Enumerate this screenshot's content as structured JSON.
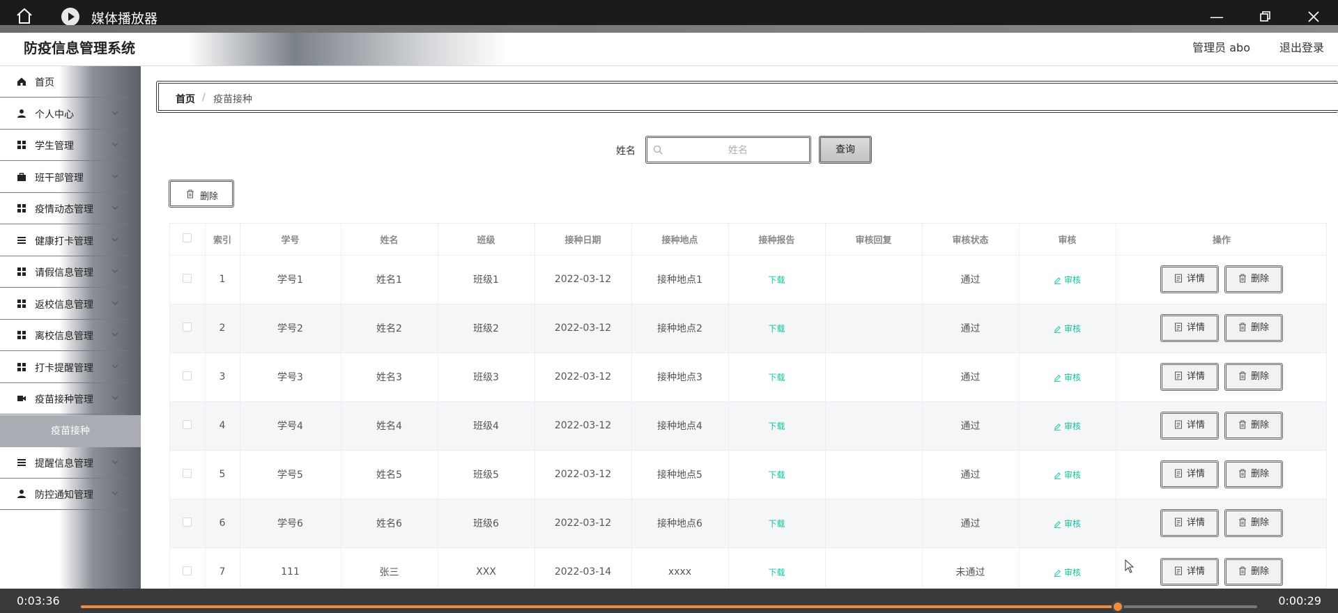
{
  "player": {
    "title": "媒体播放器",
    "time_elapsed": "0:03:36",
    "time_remaining": "0:00:29",
    "progress": 0.8813
  },
  "header": {
    "title": "防疫信息管理系统",
    "user": "管理员 abo",
    "logout": "退出登录"
  },
  "sidebar": {
    "items": [
      {
        "label": "首页",
        "icon": "home-icon",
        "chevron": false
      },
      {
        "label": "个人中心",
        "icon": "user-icon",
        "chevron": true
      },
      {
        "label": "学生管理",
        "icon": "grid-icon",
        "chevron": true
      },
      {
        "label": "班干部管理",
        "icon": "briefcase-icon",
        "chevron": true
      },
      {
        "label": "疫情动态管理",
        "icon": "grid-icon",
        "chevron": true
      },
      {
        "label": "健康打卡管理",
        "icon": "list-icon",
        "chevron": true
      },
      {
        "label": "请假信息管理",
        "icon": "grid-icon",
        "chevron": true
      },
      {
        "label": "返校信息管理",
        "icon": "grid-icon",
        "chevron": true
      },
      {
        "label": "离校信息管理",
        "icon": "grid-icon",
        "chevron": true
      },
      {
        "label": "打卡提醒管理",
        "icon": "grid-icon",
        "chevron": true
      },
      {
        "label": "疫苗接种管理",
        "icon": "camera-icon",
        "chevron": true
      },
      {
        "label": "提醒信息管理",
        "icon": "list-icon",
        "chevron": true
      },
      {
        "label": "防控通知管理",
        "icon": "user-icon",
        "chevron": true
      }
    ],
    "active_sub": "疫苗接种"
  },
  "breadcrumb": {
    "home": "首页",
    "separator": "/",
    "current": "疫苗接种"
  },
  "search": {
    "label": "姓名",
    "placeholder": "姓名",
    "button": "查询"
  },
  "bulk_delete": "删除",
  "table": {
    "columns": [
      "",
      "索引",
      "学号",
      "姓名",
      "班级",
      "接种日期",
      "接种地点",
      "接种报告",
      "审核回复",
      "审核状态",
      "审核",
      "操作"
    ],
    "rows": [
      {
        "index": "1",
        "sid": "学号1",
        "name": "姓名1",
        "cls": "班级1",
        "date": "2022-03-12",
        "place": "接种地点1",
        "report": "下载",
        "reply": "",
        "status": "通过",
        "audit": "审核"
      },
      {
        "index": "2",
        "sid": "学号2",
        "name": "姓名2",
        "cls": "班级2",
        "date": "2022-03-12",
        "place": "接种地点2",
        "report": "下载",
        "reply": "",
        "status": "通过",
        "audit": "审核"
      },
      {
        "index": "3",
        "sid": "学号3",
        "name": "姓名3",
        "cls": "班级3",
        "date": "2022-03-12",
        "place": "接种地点3",
        "report": "下载",
        "reply": "",
        "status": "通过",
        "audit": "审核"
      },
      {
        "index": "4",
        "sid": "学号4",
        "name": "姓名4",
        "cls": "班级4",
        "date": "2022-03-12",
        "place": "接种地点4",
        "report": "下载",
        "reply": "",
        "status": "通过",
        "audit": "审核"
      },
      {
        "index": "5",
        "sid": "学号5",
        "name": "姓名5",
        "cls": "班级5",
        "date": "2022-03-12",
        "place": "接种地点5",
        "report": "下载",
        "reply": "",
        "status": "通过",
        "audit": "审核"
      },
      {
        "index": "6",
        "sid": "学号6",
        "name": "姓名6",
        "cls": "班级6",
        "date": "2022-03-12",
        "place": "接种地点6",
        "report": "下载",
        "reply": "",
        "status": "通过",
        "audit": "审核"
      },
      {
        "index": "7",
        "sid": "111",
        "name": "张三",
        "cls": "XXX",
        "date": "2022-03-14",
        "place": "xxxx",
        "report": "下载",
        "reply": "",
        "status": "未通过",
        "audit": "审核"
      }
    ],
    "op_detail": "详情",
    "op_delete": "删除"
  },
  "colors": {
    "accent_green": "#13c3a0",
    "player_progress": "#f08c3c"
  }
}
